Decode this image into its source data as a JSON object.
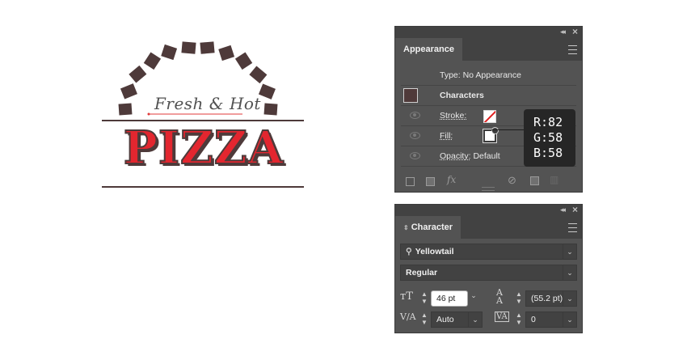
{
  "artwork": {
    "subtitle": "Fresh & Hot",
    "title": "PIZZA",
    "colors": {
      "brown": "#4e3a3a",
      "red": "#e3262f",
      "subtitle": "#525252"
    }
  },
  "appearance_panel": {
    "tab": "Appearance",
    "type_line": "Type: No Appearance",
    "characters": "Characters",
    "stroke_label": "Stroke:",
    "fill_label": "Fill:",
    "opacity_label": "Opacity:",
    "opacity_value": "Default",
    "fx_label": "fx"
  },
  "color_tooltip": {
    "r": "R:82",
    "g": "G:58",
    "b": "B:58"
  },
  "character_panel": {
    "tab": "Character",
    "font_family": "Yellowtail",
    "font_style": "Regular",
    "font_size": "46 pt",
    "leading": "(55.2 pt)",
    "kerning": "Auto",
    "tracking": "0"
  }
}
